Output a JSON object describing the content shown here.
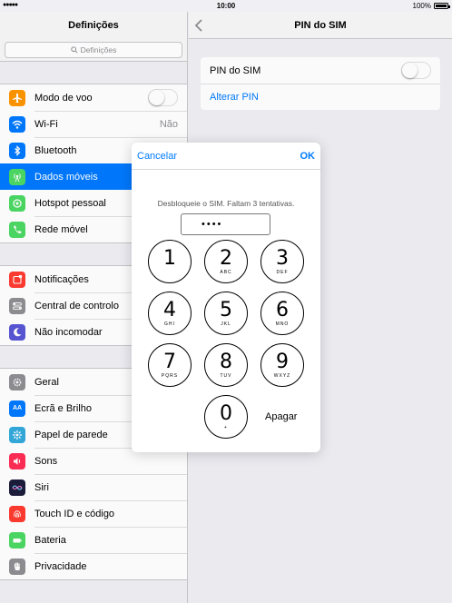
{
  "status": {
    "time": "10:00",
    "battery": "100%"
  },
  "sidebar": {
    "title": "Definições",
    "search_placeholder": "Definições",
    "groups": [
      [
        {
          "label": "Modo de voo",
          "icon": "airplane-icon",
          "color": "#ff9500",
          "control": "toggle"
        },
        {
          "label": "Wi-Fi",
          "icon": "wifi-icon",
          "color": "#007aff",
          "value": "Não"
        },
        {
          "label": "Bluetooth",
          "icon": "bluetooth-icon",
          "color": "#007aff"
        },
        {
          "label": "Dados móveis",
          "icon": "antenna-icon",
          "color": "#4cd964",
          "selected": true
        },
        {
          "label": "Hotspot pessoal",
          "icon": "hotspot-icon",
          "color": "#4cd964"
        },
        {
          "label": "Rede móvel",
          "icon": "phone-icon",
          "color": "#4cd964"
        }
      ],
      [
        {
          "label": "Notificações",
          "icon": "notifications-icon",
          "color": "#ff3b30"
        },
        {
          "label": "Central de controlo",
          "icon": "control-center-icon",
          "color": "#8e8e93"
        },
        {
          "label": "Não incomodar",
          "icon": "moon-icon",
          "color": "#5856d6"
        }
      ],
      [
        {
          "label": "Geral",
          "icon": "gear-icon",
          "color": "#8e8e93"
        },
        {
          "label": "Ecrã e Brilho",
          "icon": "display-icon",
          "color": "#007aff"
        },
        {
          "label": "Papel de parede",
          "icon": "wallpaper-icon",
          "color": "#34aadc"
        },
        {
          "label": "Sons",
          "icon": "speaker-icon",
          "color": "#ff2d55"
        },
        {
          "label": "Siri",
          "icon": "siri-icon",
          "color": "#1c1c3c"
        },
        {
          "label": "Touch ID e código",
          "icon": "fingerprint-icon",
          "color": "#ff3b30"
        },
        {
          "label": "Bateria",
          "icon": "battery-icon",
          "color": "#4cd964"
        },
        {
          "label": "Privacidade",
          "icon": "hand-icon",
          "color": "#8e8e93"
        }
      ]
    ]
  },
  "detail": {
    "title": "PIN do SIM",
    "pin_toggle_label": "PIN do SIM",
    "change_pin_label": "Alterar PIN"
  },
  "modal": {
    "cancel": "Cancelar",
    "ok": "OK",
    "message": "Desbloqueie o SIM. Faltam 3 tentativas.",
    "pin_value": "••••",
    "delete": "Apagar",
    "keys": [
      {
        "num": "1",
        "letters": ""
      },
      {
        "num": "2",
        "letters": "ABC"
      },
      {
        "num": "3",
        "letters": "DEF"
      },
      {
        "num": "4",
        "letters": "GHI"
      },
      {
        "num": "5",
        "letters": "JKL"
      },
      {
        "num": "6",
        "letters": "MNO"
      },
      {
        "num": "7",
        "letters": "PQRS"
      },
      {
        "num": "8",
        "letters": "TUV"
      },
      {
        "num": "9",
        "letters": "WXYZ"
      },
      {
        "num": "0",
        "letters": "+"
      }
    ]
  }
}
